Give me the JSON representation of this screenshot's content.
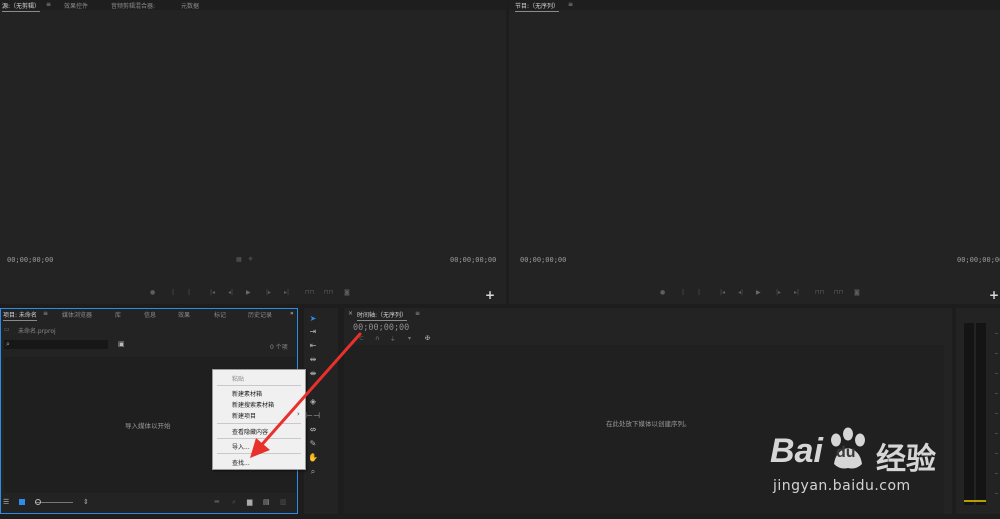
{
  "source_monitor": {
    "tabs": [
      "源:（无剪辑）",
      "效果控件",
      "音频剪辑混合器:",
      "元数据"
    ],
    "timecode_left": "00;00;00;00",
    "timecode_right": "00;00;00;00"
  },
  "program_monitor": {
    "tabs": [
      "节目:（无序列）"
    ],
    "timecode_left": "00;00;00;00",
    "timecode_right": "00;00;00;00"
  },
  "project_panel": {
    "tabs": [
      "项目: 未命名",
      "媒体浏览器",
      "库",
      "信息",
      "效果",
      "标记",
      "历史记录"
    ],
    "file_name": "未命名.prproj",
    "item_count": "0 个项",
    "empty_message": "导入媒体以开始"
  },
  "timeline": {
    "title": "时间轴:（无序列）",
    "timecode": "00;00;00;00",
    "empty_message": "在此处放下媒体以创建序列。"
  },
  "context_menu": {
    "items": [
      {
        "label": "粘贴",
        "disabled": true
      },
      {
        "label": "新建素材箱",
        "disabled": false
      },
      {
        "label": "新建搜索素材箱",
        "disabled": false
      },
      {
        "label": "新建项目",
        "disabled": false,
        "submenu": "›"
      },
      {
        "label": "查看隐藏内容",
        "disabled": false
      },
      {
        "label": "导入...",
        "disabled": false
      },
      {
        "label": "查找...",
        "disabled": false
      }
    ]
  },
  "watermark": {
    "logo_text": "Bai",
    "logo_text2": "du",
    "logo_cn": "经验",
    "url": "jingyan.baidu.com"
  },
  "colors": {
    "accent_blue": "#2d8ceb",
    "annotation_red": "#e8302c",
    "context_menu_bg": "#f0f0f0"
  }
}
